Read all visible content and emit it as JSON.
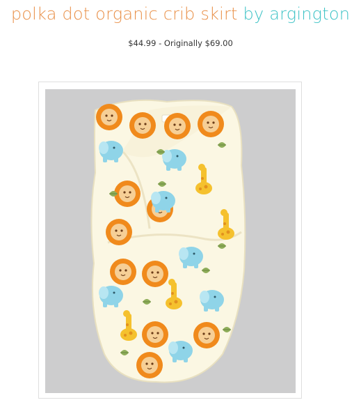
{
  "product": {
    "name": "polka dot organic crib skirt",
    "by_label": "by",
    "brand": "argington",
    "price": "$44.99",
    "price_separator": " - ",
    "original_price_label": "Originally $69.00"
  },
  "image": {
    "subject": "swaddle-wrap-photo"
  },
  "colors": {
    "title_product": "#e9914a",
    "title_brand": "#3fc3c6",
    "photo_background": "#cdcdce",
    "fabric": "#fbf7e3"
  }
}
